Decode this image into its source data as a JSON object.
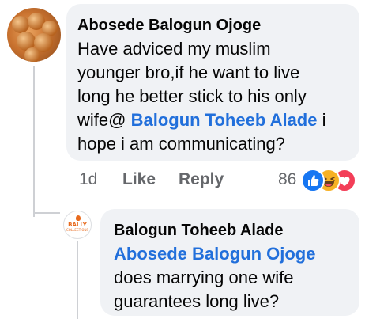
{
  "comment": {
    "author": "Abosede Balogun Ojoge",
    "text_lines": [
      "Have adviced my muslim",
      "younger bro,if he want to live",
      "long he better stick to his only",
      "wife@ "
    ],
    "mention": "Balogun Toheeb Alade",
    "mention_suffix": " i",
    "text_last_line": "hope i am communicating?",
    "time": "1d",
    "like_label": "Like",
    "reply_label": "Reply",
    "reaction_count": "86",
    "reactions": [
      "like-icon",
      "haha-icon",
      "love-icon"
    ]
  },
  "reply": {
    "author": "Balogun Toheeb Alade",
    "mention": "Abosede Balogun Ojoge",
    "text_lines": [
      "does marrying one wife",
      "guarantees long live?"
    ],
    "avatar_text": "BALLY",
    "avatar_subtext": "COLLECTIONS"
  },
  "colors": {
    "bubble": "#f0f2f5",
    "mention": "#216fdb",
    "meta": "#65676b",
    "like": "#1877f2",
    "haha": "#f7b125",
    "love": "#f33e58"
  }
}
